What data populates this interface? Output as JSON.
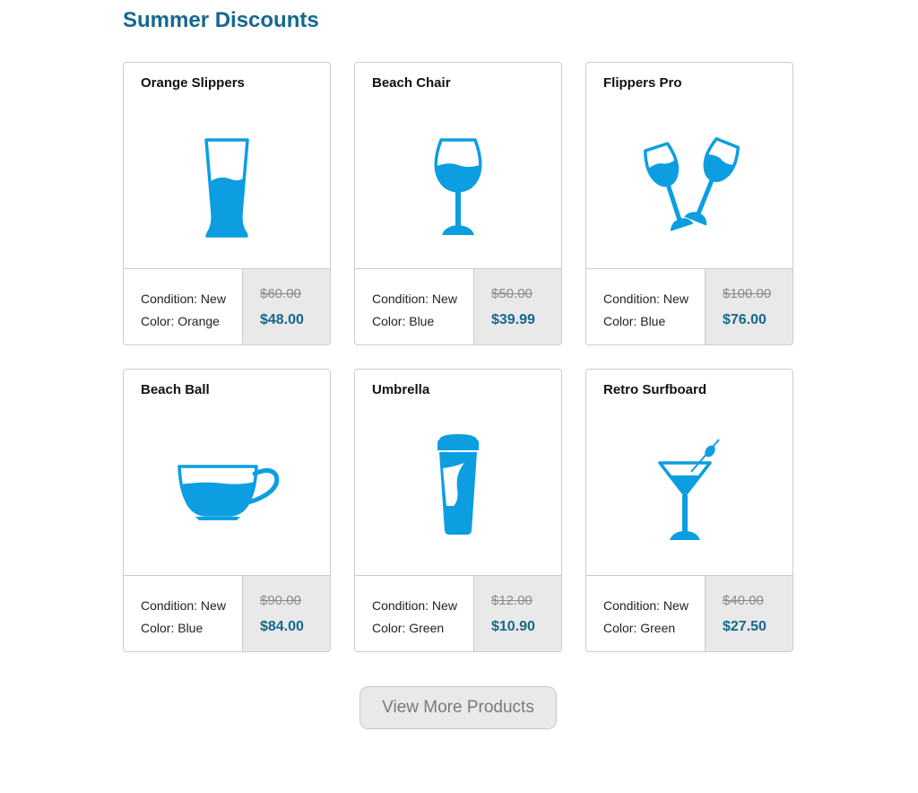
{
  "page": {
    "title": "Summer Discounts"
  },
  "colors": {
    "accent": "#15688f",
    "icon": "#0c9ee0",
    "price_bg": "#e9e9e9"
  },
  "products": [
    {
      "name": "Orange Slippers",
      "icon": "tall-glass-icon",
      "condition": "Condition: New",
      "color": "Color: Orange",
      "old_price": "$60.00",
      "new_price": "$48.00"
    },
    {
      "name": "Beach Chair",
      "icon": "wine-glass-icon",
      "condition": "Condition: New",
      "color": "Color: Blue",
      "old_price": "$50.00",
      "new_price": "$39.99"
    },
    {
      "name": "Flippers Pro",
      "icon": "cheers-glasses-icon",
      "condition": "Condition: New",
      "color": "Color: Blue",
      "old_price": "$100.00",
      "new_price": "$76.00"
    },
    {
      "name": "Beach Ball",
      "icon": "coffee-cup-icon",
      "condition": "Condition: New",
      "color": "Color: Blue",
      "old_price": "$90.00",
      "new_price": "$84.00"
    },
    {
      "name": "Umbrella",
      "icon": "travel-mug-icon",
      "condition": "Condition: New",
      "color": "Color: Green",
      "old_price": "$12.00",
      "new_price": "$10.90"
    },
    {
      "name": "Retro Surfboard",
      "icon": "martini-glass-icon",
      "condition": "Condition: New",
      "color": "Color: Green",
      "old_price": "$40.00",
      "new_price": "$27.50"
    }
  ],
  "actions": {
    "more_label": "View More Products"
  }
}
